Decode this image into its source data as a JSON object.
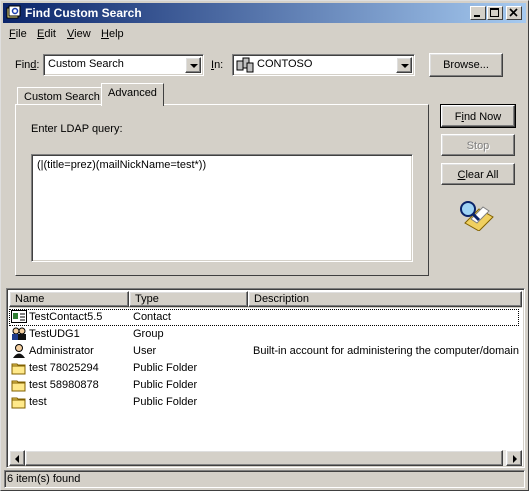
{
  "window": {
    "title": "Find Custom Search"
  },
  "menu": [
    {
      "label": "File",
      "acc": "F",
      "rest": "ile"
    },
    {
      "label": "Edit",
      "acc": "E",
      "rest": "dit"
    },
    {
      "label": "View",
      "acc": "V",
      "rest": "iew"
    },
    {
      "label": "Help",
      "acc": "H",
      "rest": "elp"
    }
  ],
  "find": {
    "label_pre": "Fin",
    "label_acc": "d",
    "label_post": ":",
    "value": "Custom Search"
  },
  "in": {
    "label_acc": "I",
    "label_post": "n:",
    "value": "CONTOSO"
  },
  "buttons": {
    "browse": "Browse...",
    "find_now_acc": "i",
    "find_now_pre": "F",
    "find_now_post": "nd Now",
    "stop": "Stop",
    "clear_all_acc": "C",
    "clear_all_post": "lear All"
  },
  "tabs": [
    {
      "label": "Custom Search"
    },
    {
      "label": "Advanced",
      "active": true
    }
  ],
  "advanced": {
    "prompt": "Enter LDAP query:",
    "query": "(|(title=prez)(mailNickName=test*))"
  },
  "results": {
    "columns": [
      "Name",
      "Type",
      "Description"
    ],
    "rows": [
      {
        "name": "TestContact5.5",
        "type": "Contact",
        "description": "",
        "icon": "contact-icon"
      },
      {
        "name": "TestUDG1",
        "type": "Group",
        "description": "",
        "icon": "group-icon"
      },
      {
        "name": "Administrator",
        "type": "User",
        "description": "Built-in account for administering the computer/domain",
        "icon": "user-icon"
      },
      {
        "name": "test 78025294",
        "type": "Public Folder",
        "description": "",
        "icon": "folder-icon"
      },
      {
        "name": "test 58980878",
        "type": "Public Folder",
        "description": "",
        "icon": "folder-icon"
      },
      {
        "name": "test",
        "type": "Public Folder",
        "description": "",
        "icon": "folder-icon"
      }
    ]
  },
  "status": {
    "text": "6 item(s) found"
  }
}
